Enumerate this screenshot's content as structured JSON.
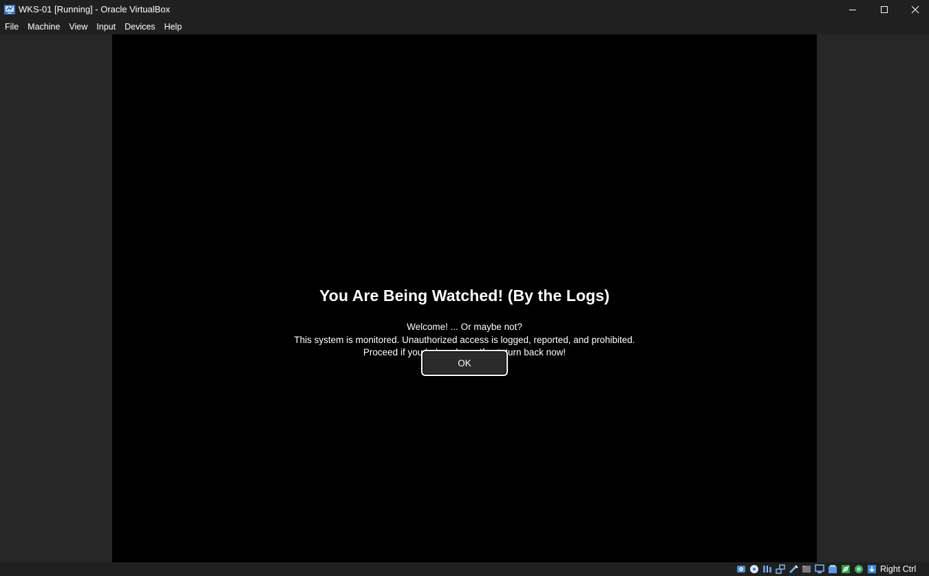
{
  "window": {
    "title": "WKS-01 [Running] - Oracle VirtualBox",
    "app_icon": "virtualbox-icon"
  },
  "menu": {
    "items": [
      {
        "label": "File"
      },
      {
        "label": "Machine"
      },
      {
        "label": "View"
      },
      {
        "label": "Input"
      },
      {
        "label": "Devices"
      },
      {
        "label": "Help"
      }
    ]
  },
  "vm": {
    "banner_title": "You Are Being Watched! (By the Logs)",
    "banner_lines": [
      "Welcome! ... Or maybe not?",
      "This system is monitored. Unauthorized access is logged, reported, and prohibited.",
      "Proceed if you belong here. If not, turn back now!"
    ],
    "ok_label": "OK"
  },
  "statusbar": {
    "icons": [
      "hard-disk-icon",
      "optical-drive-icon",
      "audio-icon",
      "network-icon",
      "usb-icon",
      "shared-folders-icon",
      "display-icon",
      "recording-icon",
      "cpu-icon",
      "mouse-integration-icon",
      "keyboard-icon"
    ],
    "host_key": "Right Ctrl"
  },
  "colors": {
    "titlebar_bg": "#202020",
    "vm_bg": "#272727",
    "vm_screen": "#000000",
    "text": "#ffffff"
  }
}
